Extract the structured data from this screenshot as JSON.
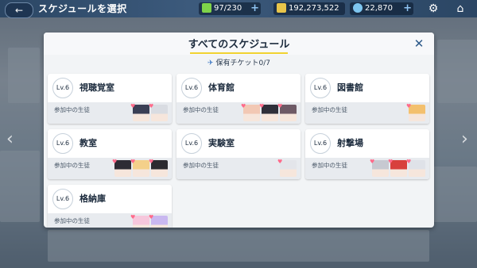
{
  "header": {
    "title": "スケジュールを選択",
    "ap": "97/230",
    "credits": "192,273,522",
    "pyroxene": "22,870"
  },
  "colors": {
    "accent": "#f1d230",
    "brand": "#2b4664",
    "ticket": "#3d78c4"
  },
  "modal": {
    "title": "すべてのスケジュール",
    "ticket_label": "保有チケット0/7"
  },
  "schedules": [
    {
      "level": "Lv.6",
      "name": "視聴覚室",
      "sub": "参加中の生徒",
      "students": [
        "#3a3f55",
        "#d9dce2"
      ]
    },
    {
      "level": "Lv.6",
      "name": "体育館",
      "sub": "参加中の生徒",
      "students": [
        "#f2c8b4",
        "#2e2f3a",
        "#6e5a66"
      ]
    },
    {
      "level": "Lv.6",
      "name": "図書館",
      "sub": "参加中の生徒",
      "students": [
        "#f3c06e"
      ]
    },
    {
      "level": "Lv.6",
      "name": "教室",
      "sub": "参加中の生徒",
      "students": [
        "#2d2b34",
        "#f4d08a",
        "#2b2a30"
      ]
    },
    {
      "level": "Lv.6",
      "name": "実験室",
      "sub": "参加中の生徒",
      "students": [
        "#e3e5ea"
      ]
    },
    {
      "level": "Lv.6",
      "name": "射撃場",
      "sub": "参加中の生徒",
      "students": [
        "#c7c9d1",
        "#d8403d",
        "#dfe2e8"
      ]
    },
    {
      "level": "Lv.6",
      "name": "格納庫",
      "sub": "参加中の生徒",
      "students": [
        "#f6c7dc",
        "#c9b8f0"
      ]
    }
  ]
}
